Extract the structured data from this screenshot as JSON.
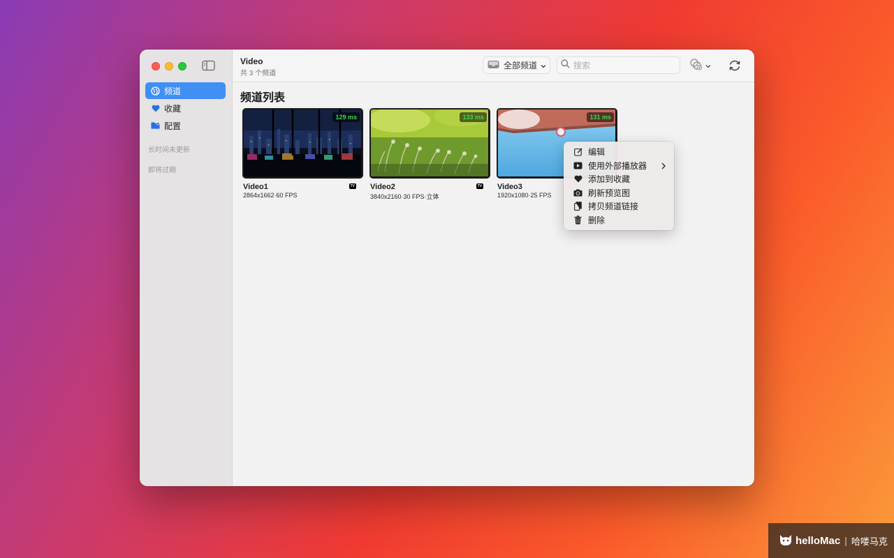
{
  "window": {
    "toolbar": {
      "title": "Video",
      "subtitle": "共 3 个频道",
      "channel_filter": "全部频道",
      "search_placeholder": "搜索"
    },
    "sidebar": {
      "items": [
        {
          "label": "频道",
          "icon": "globe-icon",
          "active": true
        },
        {
          "label": "收藏",
          "icon": "heart-icon",
          "active": false
        },
        {
          "label": "配置",
          "icon": "folder-icon",
          "active": false
        }
      ],
      "sections": [
        "长时间未更新",
        "即将过期"
      ]
    },
    "main": {
      "title": "频道列表",
      "cards": [
        {
          "name": "Video1",
          "meta": "2864x1662·60 FPS",
          "latency": "129 ms",
          "badge": "TV"
        },
        {
          "name": "Video2",
          "meta": "3840x2160·30 FPS·立体",
          "latency": "133 ms",
          "badge": "TV"
        },
        {
          "name": "Video3",
          "meta": "1920x1080·25 FPS",
          "latency": "131 ms",
          "badge": ""
        }
      ]
    }
  },
  "context_menu": {
    "items": [
      {
        "label": "编辑",
        "icon": "edit-icon"
      },
      {
        "label": "使用外部播放器",
        "icon": "play-icon",
        "submenu": true
      },
      {
        "label": "添加到收藏",
        "icon": "heart-icon"
      },
      {
        "label": "刷新预览图",
        "icon": "camera-icon"
      },
      {
        "label": "拷贝频道链接",
        "icon": "copy-icon"
      },
      {
        "label": "删除",
        "icon": "trash-icon"
      }
    ]
  },
  "watermark": {
    "brand": "helloMac",
    "cn": "哈喽马克"
  },
  "colors": {
    "accent": "#3f8ff5",
    "latency": "#3adb4a"
  }
}
